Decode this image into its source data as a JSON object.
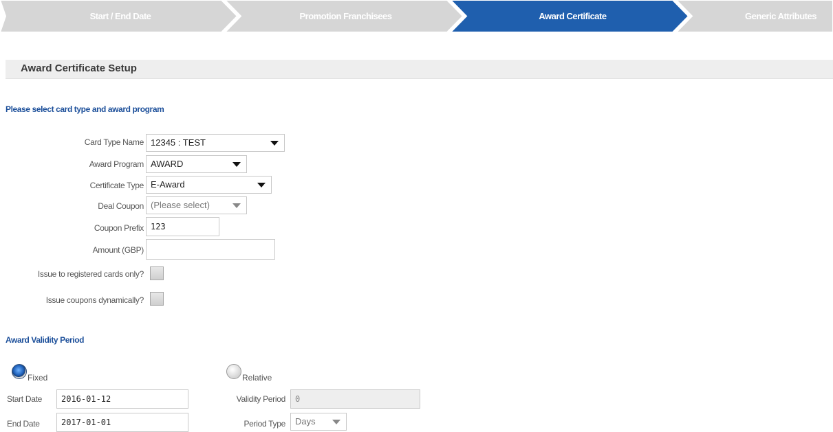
{
  "wizard": {
    "steps": [
      {
        "label": "Start / End Date",
        "active": false
      },
      {
        "label": "Promotion Franchisees",
        "active": false
      },
      {
        "label": "Award Certificate",
        "active": true
      },
      {
        "label": "Generic Attributes",
        "active": false
      }
    ],
    "colors": {
      "inactive": "#d6d6d6",
      "active": "#1f5fae"
    }
  },
  "section": {
    "title": "Award Certificate Setup"
  },
  "card_section": {
    "heading": "Please select card type and award program",
    "fields": {
      "card_type": {
        "label": "Card Type Name",
        "value": "12345 : TEST"
      },
      "award_program": {
        "label": "Award Program",
        "value": "AWARD"
      },
      "certificate_type": {
        "label": "Certificate Type",
        "value": "E-Award"
      },
      "deal_coupon": {
        "label": "Deal Coupon",
        "value": "(Please select)"
      },
      "coupon_prefix": {
        "label": "Coupon Prefix",
        "value": "123"
      },
      "amount": {
        "label": "Amount (GBP)",
        "value": ""
      },
      "registered_only": {
        "label": "Issue to registered cards only?",
        "checked": false
      },
      "dynamic": {
        "label": "Issue coupons dynamically?",
        "checked": false
      }
    }
  },
  "validity": {
    "heading": "Award Validity Period",
    "fixed": {
      "label": "Fixed",
      "selected": true
    },
    "relative": {
      "label": "Relative",
      "selected": false
    },
    "start_date": {
      "label": "Start Date",
      "value": "2016-01-12"
    },
    "end_date": {
      "label": "End Date",
      "value": "2017-01-01"
    },
    "validity_period": {
      "label": "Validity Period",
      "value": "0"
    },
    "period_type": {
      "label": "Period Type",
      "value": "Days"
    }
  }
}
